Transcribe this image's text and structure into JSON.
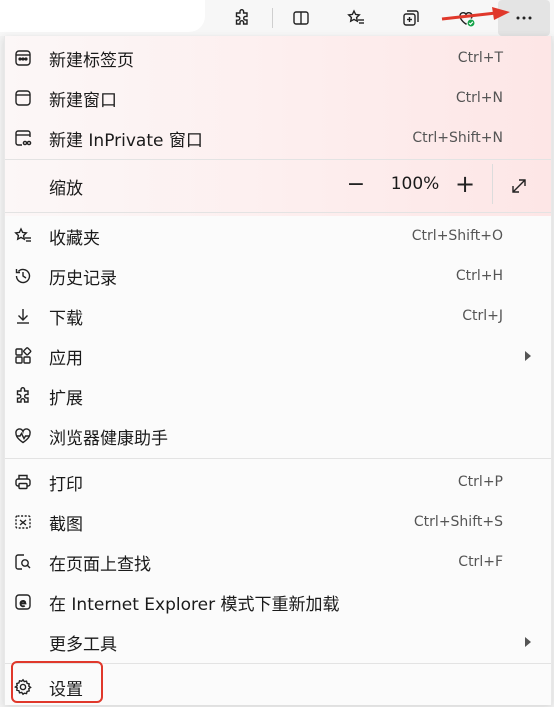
{
  "menu": {
    "items": [
      {
        "label": "新建标签页",
        "shortcut": "Ctrl+T",
        "icon": "new-tab-icon"
      },
      {
        "label": "新建窗口",
        "shortcut": "Ctrl+N",
        "icon": "new-window-icon"
      },
      {
        "label": "新建 InPrivate 窗口",
        "shortcut": "Ctrl+Shift+N",
        "icon": "inprivate-icon"
      },
      {
        "label": "收藏夹",
        "shortcut": "Ctrl+Shift+O",
        "icon": "favorites-icon"
      },
      {
        "label": "历史记录",
        "shortcut": "Ctrl+H",
        "icon": "history-icon"
      },
      {
        "label": "下载",
        "shortcut": "Ctrl+J",
        "icon": "download-icon"
      },
      {
        "label": "应用",
        "shortcut": "",
        "icon": "apps-icon"
      },
      {
        "label": "扩展",
        "shortcut": "",
        "icon": "extensions-icon"
      },
      {
        "label": "浏览器健康助手",
        "shortcut": "",
        "icon": "health-icon"
      },
      {
        "label": "打印",
        "shortcut": "Ctrl+P",
        "icon": "print-icon"
      },
      {
        "label": "截图",
        "shortcut": "Ctrl+Shift+S",
        "icon": "screenshot-icon"
      },
      {
        "label": "在页面上查找",
        "shortcut": "Ctrl+F",
        "icon": "find-icon"
      },
      {
        "label": "在 Internet Explorer 模式下重新加载",
        "shortcut": "",
        "icon": "ie-icon"
      },
      {
        "label": "更多工具",
        "shortcut": "",
        "icon": ""
      },
      {
        "label": "设置",
        "shortcut": "",
        "icon": "gear-icon"
      }
    ],
    "zoom": {
      "label": "缩放",
      "value": "100%",
      "minus": "−",
      "plus": "+"
    }
  },
  "colors": {
    "highlight": "#e0382b",
    "accent_arrow": "#e0382b"
  }
}
